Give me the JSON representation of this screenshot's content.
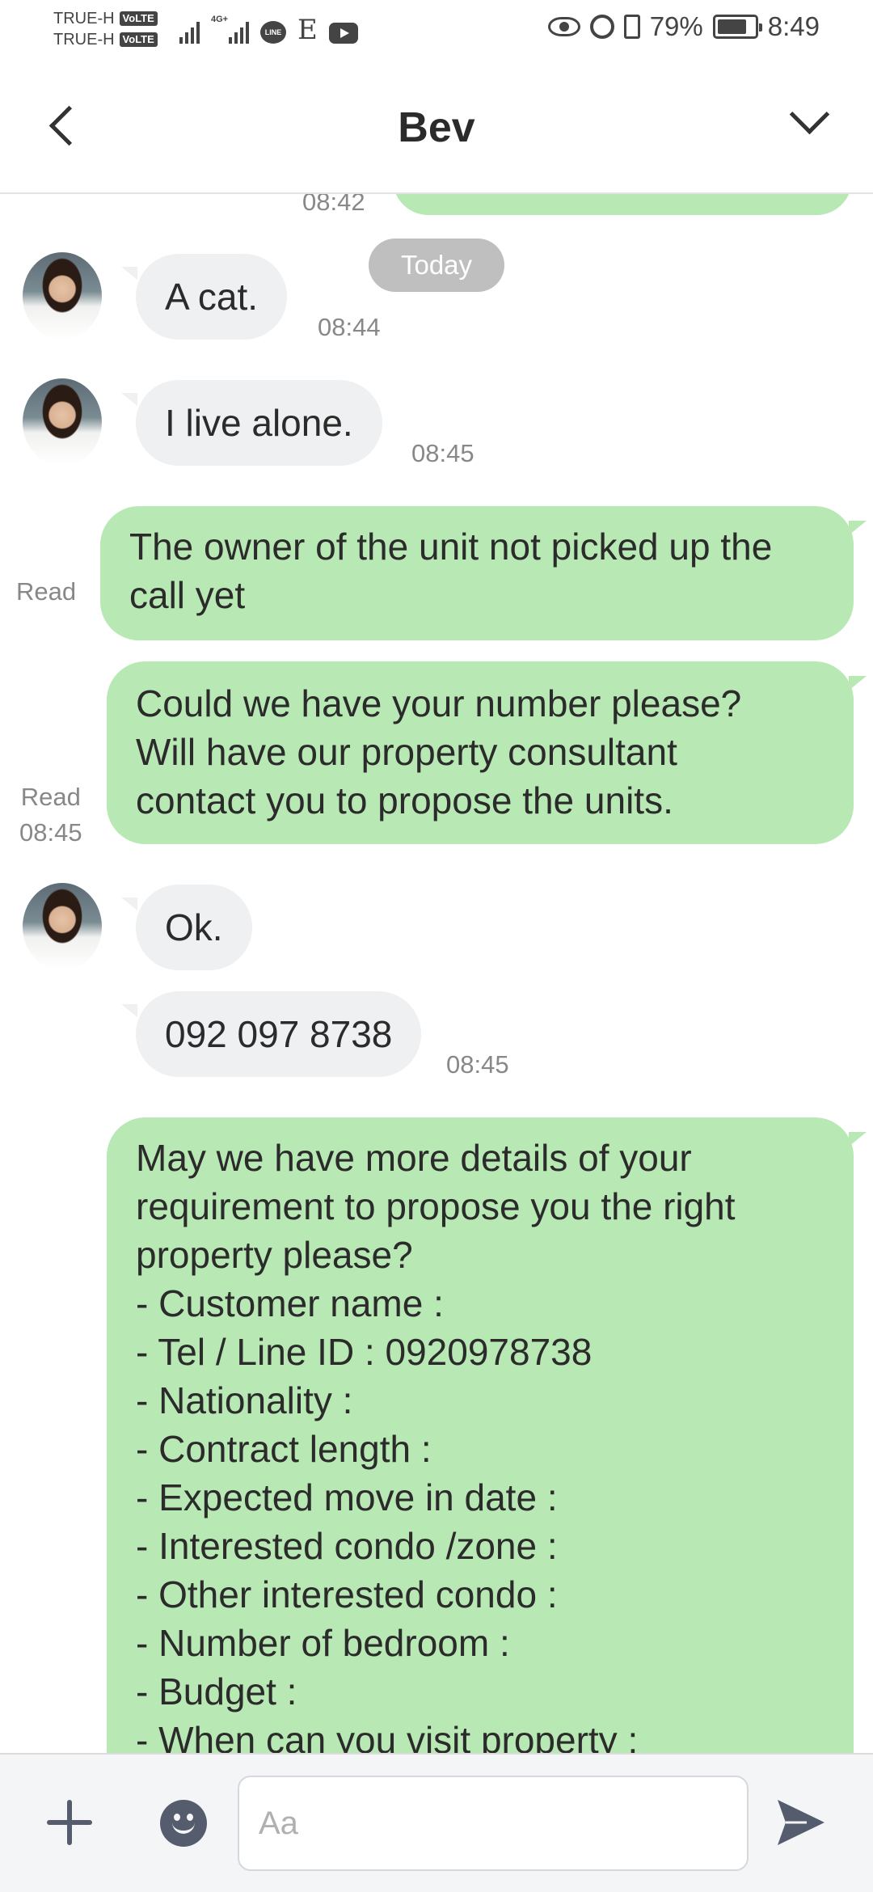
{
  "status_bar": {
    "carrier_1": "TRUE-H",
    "carrier_2": "TRUE-H",
    "volte_badge": "VoLTE",
    "network_badge": "4G+",
    "line_badge": "LINE",
    "e_label": "E",
    "battery": "79%",
    "time": "8:49"
  },
  "header": {
    "title": "Bev"
  },
  "chat": {
    "partial_time": "08:42",
    "date_divider": "Today",
    "messages": [
      {
        "side": "in",
        "text": "A cat.",
        "time": "08:44"
      },
      {
        "side": "in",
        "text": "I live alone.",
        "time": "08:45"
      },
      {
        "side": "out",
        "text": "The owner of the unit not picked up the\ncall yet",
        "status": "Read"
      },
      {
        "side": "out",
        "text": "Could we have your number please?\nWill have our property consultant\ncontact you to propose the units.",
        "status": "Read",
        "time": "08:45"
      },
      {
        "side": "in",
        "text": "Ok."
      },
      {
        "side": "in",
        "text": "092 097 8738",
        "time": "08:45"
      },
      {
        "side": "out",
        "text": "May we have more details of your\nrequirement to propose you the right\nproperty please?\n- Customer name :\n- Tel / Line ID : 0920978738\n- Nationality :\n- Contract length :\n- Expected move in date :\n- Interested condo /zone :\n- Other interested condo :\n- Number of bedroom  :\n- Budget :\n- When can you visit property :"
      }
    ]
  },
  "input_bar": {
    "placeholder": "Aa"
  }
}
